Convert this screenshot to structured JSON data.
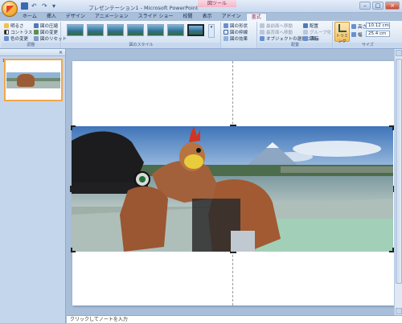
{
  "window": {
    "title": "プレゼンテーション1 - Microsoft PowerPoint",
    "context_tool": "図ツール",
    "controls": [
      "–",
      "□",
      "×"
    ]
  },
  "tabs": [
    "ホーム",
    "挿入",
    "デザイン",
    "アニメーション",
    "スライド ショー",
    "校閲",
    "表示",
    "アドイン",
    "書式"
  ],
  "active_tab": "書式",
  "ribbon": {
    "adjust": {
      "label": "調整",
      "brightness": "明るさ",
      "contrast": "コントラスト",
      "recolor": "色の変更",
      "compress": "図の圧縮",
      "change": "図の変更",
      "reset": "図のリセット"
    },
    "styles": {
      "label": "図のスタイル",
      "shape": "図の形状",
      "border": "図の枠線",
      "effects": "図の効果"
    },
    "arrange": {
      "label": "配置",
      "bring_front": "最前面へ移動",
      "send_back": "最背面へ移動",
      "selection_pane": "オブジェクトの選択と表示",
      "align": "配置",
      "group": "グループ化",
      "rotate": "回転"
    },
    "size": {
      "label": "サイズ",
      "crop": "トリミング",
      "height_label": "高さ",
      "height_value": "10.12 cm",
      "width_label": "幅",
      "width_value": "25.4 cm"
    }
  },
  "thumbnail_number": "1",
  "notes_placeholder": "クリックしてノートを入力",
  "colors": {
    "accent": "#f1a74a",
    "ribbon": "#dde8f5",
    "background": "#a9bfd9"
  }
}
